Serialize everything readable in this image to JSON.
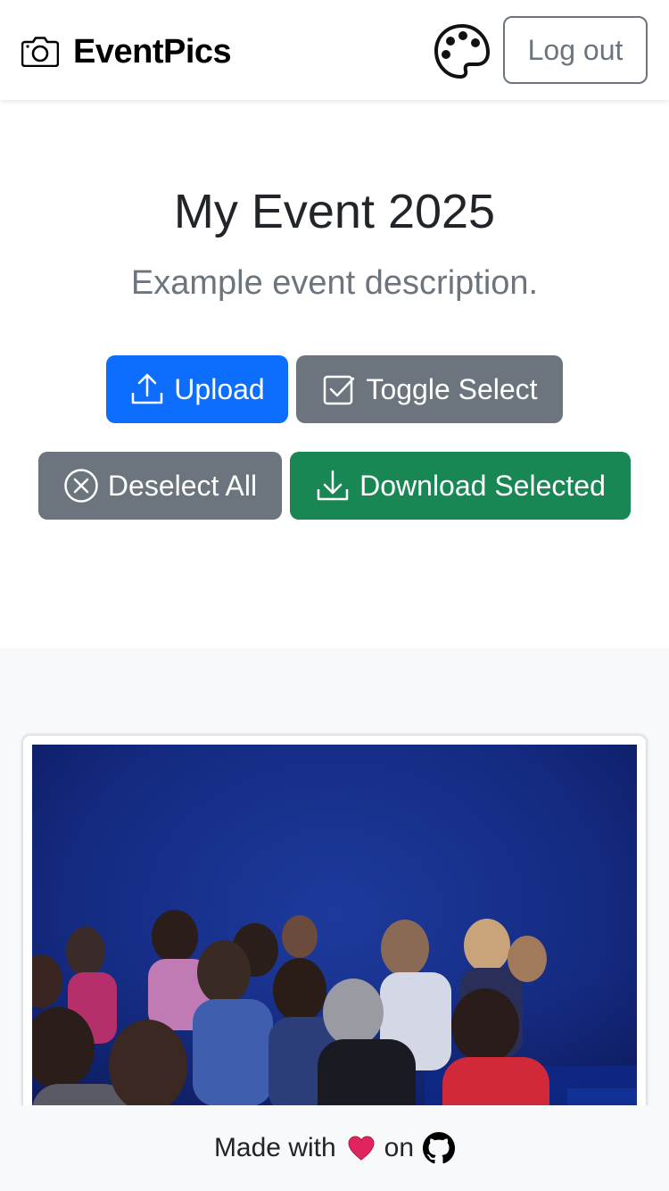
{
  "navbar": {
    "brand_icon": "camera-icon",
    "brand_name": "EventPics",
    "theme_icon": "palette-icon",
    "logout_label": "Log out"
  },
  "event": {
    "title": "My Event 2025",
    "description": "Example event description."
  },
  "actions": {
    "upload_label": "Upload",
    "upload_icon": "upload-icon",
    "toggle_select_label": "Toggle Select",
    "toggle_select_icon": "check-square-icon",
    "deselect_all_label": "Deselect All",
    "deselect_all_icon": "x-circle-icon",
    "download_selected_label": "Download Selected",
    "download_selected_icon": "download-icon"
  },
  "gallery": {
    "photos": [
      {
        "subject": "audience-in-theater-photo"
      }
    ]
  },
  "footer": {
    "made_with": "Made with",
    "heart_icon": "heart-icon",
    "on": "on",
    "github_icon": "github-icon"
  },
  "colors": {
    "primary": "#0d6efd",
    "secondary": "#6c757d",
    "success": "#198754",
    "light_bg": "#f8f9fa",
    "heart": "#e0245e"
  }
}
